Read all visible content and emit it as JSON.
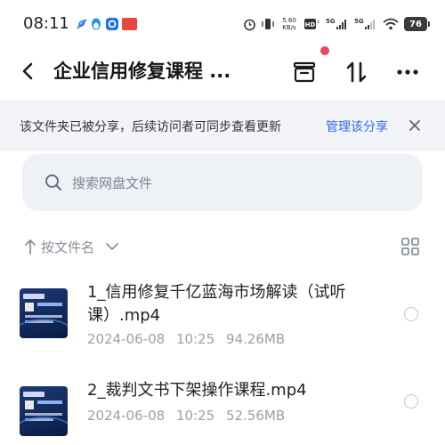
{
  "status_bar": {
    "time": "08:11",
    "net_speed_value": "5.60",
    "net_speed_unit": "KB/s",
    "hd_label": "HD",
    "sim1_network": "5G",
    "sim2_network": "5G",
    "battery": "76"
  },
  "header": {
    "title": "企业信用修复课程 ...",
    "icons": [
      "archive-icon",
      "sort-transfer-icon",
      "more-icon"
    ],
    "notification_dot_color": "#f2445a"
  },
  "share_banner": {
    "text": "该文件夹已被分享，后续访问者可同步查看更新",
    "link": "管理该分享",
    "link_color": "#2f6cf5"
  },
  "search": {
    "placeholder": "搜索网盘文件"
  },
  "sort": {
    "label": "按文件名"
  },
  "files": [
    {
      "name": "1_信用修复千亿蓝海市场解读（试听课）.mp4",
      "date": "2024-06-08",
      "time": "10:25",
      "size": "94.26MB"
    },
    {
      "name": "2_裁判文书下架操作课程.mp4",
      "date": "2024-06-08",
      "time": "10:25",
      "size": "52.56MB"
    }
  ]
}
